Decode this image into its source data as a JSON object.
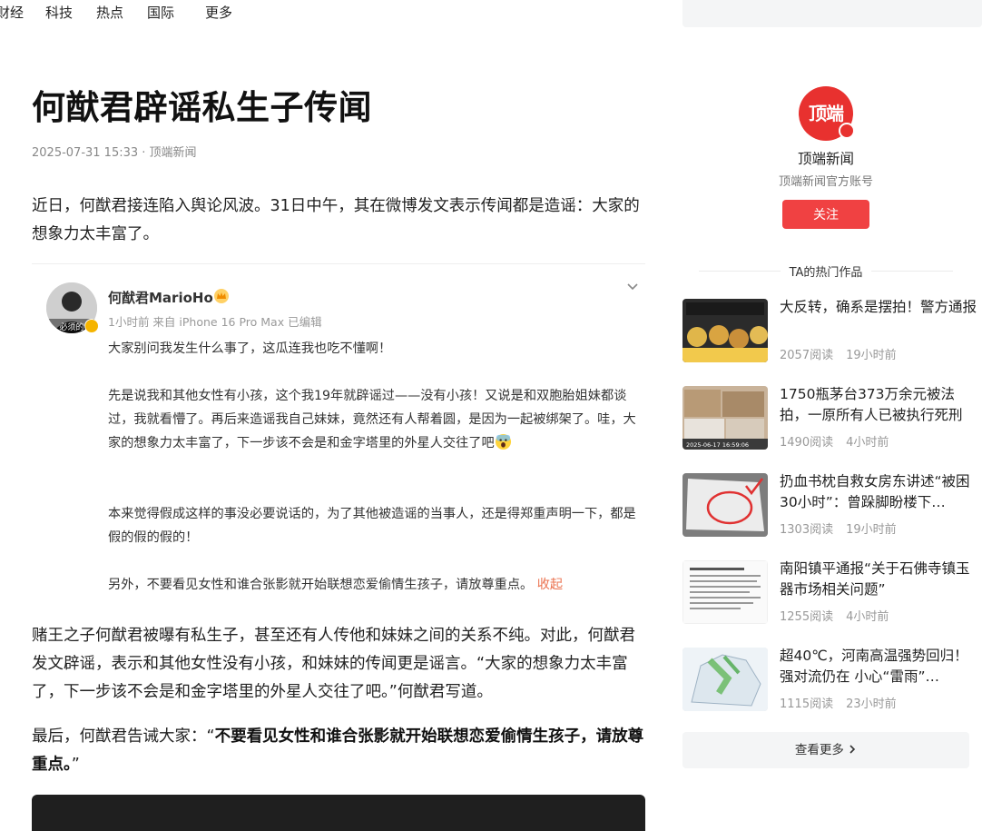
{
  "top_nav": [
    "财经",
    "科技",
    "热点",
    "国际",
    "更多"
  ],
  "article": {
    "title": "何猷君辟谣私生子传闻",
    "meta": "2025-07-31 15:33 · 顶端新闻",
    "intro": "近日，何猷君接连陷入舆论风波。31日中午，其在微博发文表示传闻都是造谣：大家的想象力太丰富了。",
    "weibo": {
      "avatar_text": "必须的",
      "username": "何猷君MarioHo",
      "meta": "1小时前 来自 iPhone 16 Pro Max 已编辑",
      "p1": "大家别问我发生什么事了，这瓜连我也吃不懂啊！",
      "p2": "先是说我和其他女性有小孩，这个我19年就辟谣过——没有小孩！又说是和双胞胎姐妹都谈过，我就看懵了。再后来造谣我自己妹妹，竟然还有人帮着圆，是因为一起被绑架了。哇，大家的想象力太丰富了，下一步该不会是和金字塔里的外星人交往了吧",
      "p3": "本来觉得假成这样的事没必要说话的，为了其他被造谣的当事人，还是得郑重声明一下，都是假的假的假的！",
      "p4": "另外，不要看见女性和谁合张影就开始联想恋爱偷情生孩子，请放尊重点。",
      "collapse": "收起"
    },
    "para2": "赌王之子何猷君被曝有私生子，甚至还有人传他和妹妹之间的关系不纯。对此，何猷君发文辟谣，表示和其他女性没有小孩，和妹妹的传闻更是谣言。“大家的想象力太丰富了，下一步该不会是和金字塔里的外星人交往了吧。”何猷君写道。",
    "para3_lead": "最后，何猷君告诫大家：“",
    "para3_bold": "不要看见女性和谁合张影就开始联想恋爱偷情生孩子，请放尊重点。",
    "para3_tail": "”"
  },
  "author": {
    "logo_text": "顶端",
    "name": "顶端新闻",
    "desc": "顶端新闻官方账号",
    "follow": "关注"
  },
  "hot": {
    "title": "TA的热门作品",
    "items": [
      {
        "title": "大反转，确系是摆拍！警方通报",
        "reads": "2057阅读",
        "time": "19小时前"
      },
      {
        "title": "1750瓶茅台373万余元被法拍，一原所有人已被执行死刑",
        "reads": "1490阅读",
        "time": "4小时前",
        "thumb_text": "2025-06-17 16:59:06"
      },
      {
        "title": "扔血书枕自救女房东讲述“被困30小时”：曾跺脚盼楼下…",
        "reads": "1303阅读",
        "time": "19小时前"
      },
      {
        "title": "南阳镇平通报“关于石佛寺镇玉器市场相关问题”",
        "reads": "1255阅读",
        "time": "4小时前"
      },
      {
        "title": "超40℃，河南高温强势回归！强对流仍在 小心“雷雨”…",
        "reads": "1115阅读",
        "time": "23小时前"
      }
    ],
    "more": "查看更多"
  }
}
